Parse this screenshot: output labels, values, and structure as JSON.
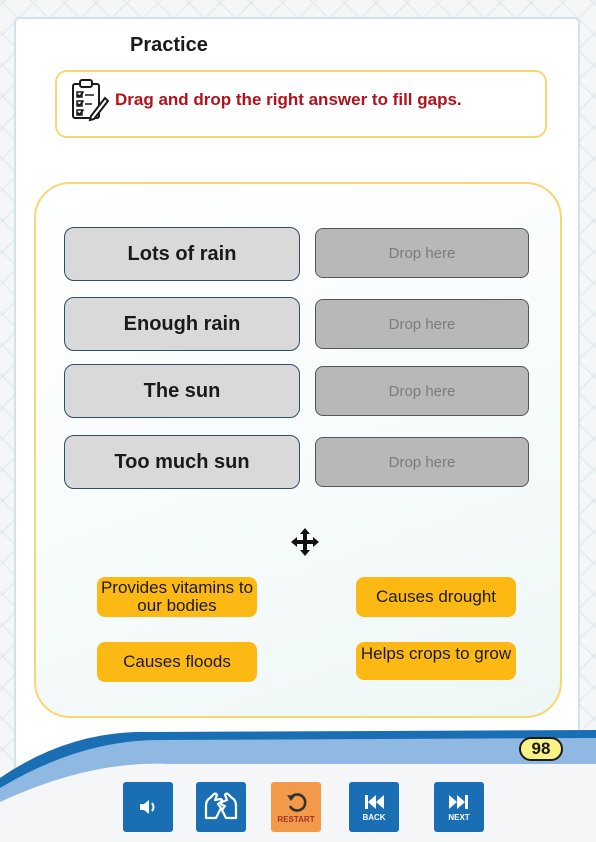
{
  "page": {
    "title": "Practice"
  },
  "instruction": {
    "text": "Drag and drop the right answer to fill gaps."
  },
  "terms": [
    {
      "label": "Lots of rain",
      "drop_placeholder": "Drop here"
    },
    {
      "label": "Enough rain",
      "drop_placeholder": "Drop here"
    },
    {
      "label": "The sun",
      "drop_placeholder": "Drop here"
    },
    {
      "label": "Too much sun",
      "drop_placeholder": "Drop here"
    }
  ],
  "answers": [
    {
      "label": "Provides vitamins to our bodies"
    },
    {
      "label": "Causes drought"
    },
    {
      "label": "Causes floods"
    },
    {
      "label": "Helps crops to grow"
    }
  ],
  "footer": {
    "page_number": "98",
    "buttons": [
      {
        "icon": "speaker-icon",
        "label": ""
      },
      {
        "icon": "sign-language-icon",
        "label": ""
      },
      {
        "icon": "restart-icon",
        "label": "RESTART"
      },
      {
        "icon": "back-icon",
        "label": "BACK"
      },
      {
        "icon": "next-icon",
        "label": "NEXT"
      }
    ]
  },
  "colors": {
    "accent_yellow": "#fdb913",
    "instruction_red": "#b3111b",
    "nav_blue": "#1a6fb4",
    "restart_orange": "#f29a4a",
    "panel_border": "#f6d873"
  }
}
